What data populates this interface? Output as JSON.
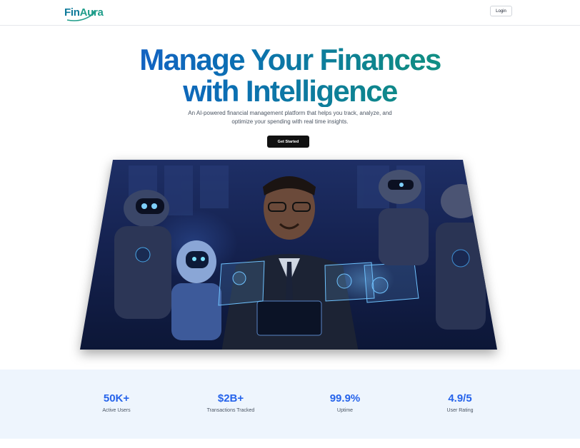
{
  "brand": {
    "name_part1": "Fin",
    "name_part2": "Aura"
  },
  "nav": {
    "login_label": "Login"
  },
  "hero": {
    "title_line1": "Manage Your Finances",
    "title_line2": "with Intelligence",
    "subtitle": "An AI-powered financial management platform that helps you track, analyze, and optimize your spending with real time insights.",
    "cta_label": "Get Started"
  },
  "stats": [
    {
      "value": "50K+",
      "label": "Active Users"
    },
    {
      "value": "$2B+",
      "label": "Transactions Tracked"
    },
    {
      "value": "99.9%",
      "label": "Uptime"
    },
    {
      "value": "4.9/5",
      "label": "User Rating"
    }
  ],
  "colors": {
    "accent": "#2563eb",
    "stats_bg": "#eef5fd",
    "cta_bg": "#111111"
  }
}
